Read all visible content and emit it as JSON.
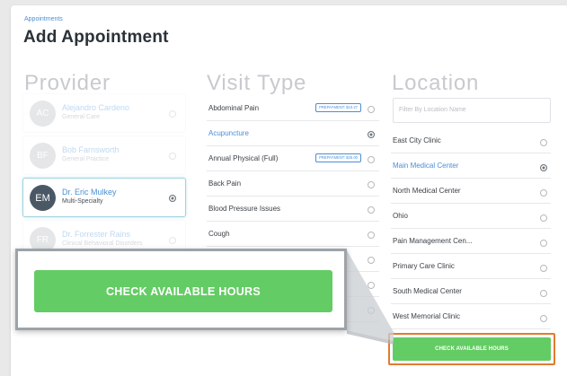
{
  "header": {
    "breadcrumb": "Appointments",
    "title": "Add Appointment"
  },
  "columns": {
    "provider": "Provider",
    "visit_type": "Visit Type",
    "location": "Location"
  },
  "providers": [
    {
      "initials": "AC",
      "name": "Alejandro Cardeno",
      "specialty": "General Care",
      "selected": false
    },
    {
      "initials": "BF",
      "name": "Bob Farnsworth",
      "specialty": "General Practice",
      "selected": false
    },
    {
      "initials": "EM",
      "name": "Dr. Eric Mulkey",
      "specialty": "Multi-Specialty",
      "selected": true
    },
    {
      "initials": "FR",
      "name": "Dr. Forrester Rains",
      "specialty": "Clinical Behavioral Disorders",
      "selected": false
    }
  ],
  "visit_types": [
    {
      "label": "Abdominal Pain",
      "prepayment": "PREPAYMENT: $10.27",
      "selected": false
    },
    {
      "label": "Acupuncture",
      "prepayment": "",
      "selected": true
    },
    {
      "label": "Annual Physical (Full)",
      "prepayment": "PREPAYMENT: $25.00",
      "selected": false
    },
    {
      "label": "Back Pain",
      "prepayment": "",
      "selected": false
    },
    {
      "label": "Blood Pressure Issues",
      "prepayment": "",
      "selected": false
    },
    {
      "label": "Cough",
      "prepayment": "",
      "selected": false
    }
  ],
  "location": {
    "filter_placeholder": "Filter By Location Name",
    "items": [
      {
        "label": "East City Clinic",
        "selected": false
      },
      {
        "label": "Main Medical Center",
        "selected": true
      },
      {
        "label": "North Medical Center",
        "selected": false
      },
      {
        "label": "Ohio",
        "selected": false
      },
      {
        "label": "Pain Management Cen...",
        "selected": false
      },
      {
        "label": "Primary Care Clinic",
        "selected": false
      },
      {
        "label": "South Medical Center",
        "selected": false
      },
      {
        "label": "West Memorial Clinic",
        "selected": false
      }
    ]
  },
  "actions": {
    "check_hours": "CHECK AVAILABLE HOURS"
  },
  "colors": {
    "accent_blue": "#4a8fd6",
    "cta_green": "#64cc64",
    "highlight_orange": "#e37b2e"
  }
}
